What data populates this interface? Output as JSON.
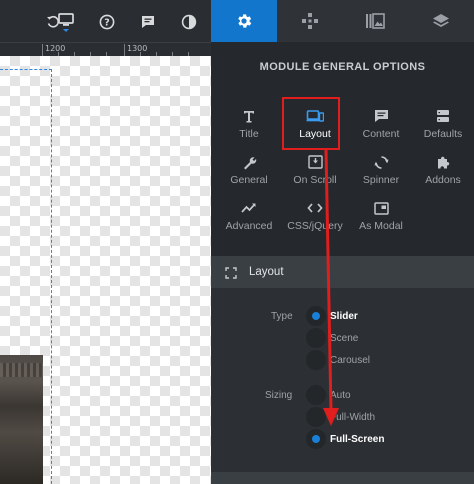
{
  "toolbar": {
    "icons": [
      "undo-icon",
      "desktop-icon",
      "help-icon",
      "comment-icon",
      "contrast-icon"
    ]
  },
  "ruler": {
    "labels": [
      "1200",
      "1300"
    ]
  },
  "panel_tabs": [
    {
      "name": "settings",
      "icon": "gear-icon",
      "active": true
    },
    {
      "name": "gamepad",
      "icon": "gamepad-icon",
      "active": false
    },
    {
      "name": "library",
      "icon": "library-icon",
      "active": false
    },
    {
      "name": "layers",
      "icon": "layers-icon",
      "active": false
    }
  ],
  "module": {
    "title": "MODULE GENERAL OPTIONS",
    "options": [
      {
        "label": "Title",
        "icon": "text-t-icon"
      },
      {
        "label": "Layout",
        "icon": "layout-icon",
        "selected": true
      },
      {
        "label": "Content",
        "icon": "content-icon"
      },
      {
        "label": "Defaults",
        "icon": "defaults-icon"
      },
      {
        "label": "General",
        "icon": "wrench-icon"
      },
      {
        "label": "On Scroll",
        "icon": "scroll-down-icon"
      },
      {
        "label": "Spinner",
        "icon": "spinner-icon"
      },
      {
        "label": "Addons",
        "icon": "puzzle-icon"
      },
      {
        "label": "Advanced",
        "icon": "trend-icon"
      },
      {
        "label": "CSS/jQuery",
        "icon": "code-icon"
      },
      {
        "label": "As Modal",
        "icon": "modal-icon"
      }
    ]
  },
  "layout_section": {
    "title": "Layout",
    "type_label": "Type",
    "type_options": [
      {
        "label": "Slider",
        "selected": true
      },
      {
        "label": "Scene",
        "selected": false
      },
      {
        "label": "Carousel",
        "selected": false
      }
    ],
    "sizing_label": "Sizing",
    "sizing_options": [
      {
        "label": "Auto",
        "selected": false
      },
      {
        "label": "Full-Width",
        "selected": false
      },
      {
        "label": "Full-Screen",
        "selected": true
      }
    ]
  },
  "colors": {
    "accent": "#1376cd",
    "annotation": "#e01e1e"
  }
}
